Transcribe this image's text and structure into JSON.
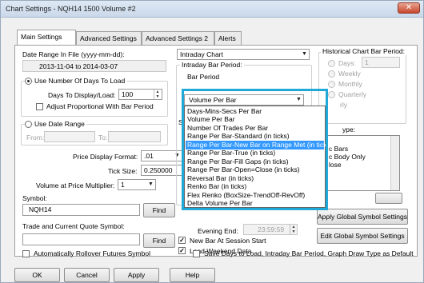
{
  "window": {
    "title": "Chart Settings - NQH14  1500 Volume  #2",
    "close_symbol": "✕"
  },
  "tabs": [
    {
      "label": "Main Settings",
      "active": true
    },
    {
      "label": "Advanced Settings",
      "active": false
    },
    {
      "label": "Advanced Settings 2",
      "active": false
    },
    {
      "label": "Alerts",
      "active": false
    }
  ],
  "date_range": {
    "label": "Date Range In File (yyyy-mm-dd):",
    "value": "2013-11-04 to 2014-03-07"
  },
  "days_group": {
    "radio_label": "Use Number Of Days To Load",
    "days_label": "Days To Display/Load:",
    "days_value": "100",
    "adjust_label": "Adjust Proportional With Bar Period"
  },
  "date_range_group": {
    "radio_label": "Use Date Range",
    "from_label": "From:",
    "to_label": "To:"
  },
  "price_format": {
    "label": "Price Display Format:",
    "value": ".01"
  },
  "tick_size": {
    "label": "Tick Size:",
    "value": "0.250000"
  },
  "volume_multiplier": {
    "label": "Volume at Price Multiplier:",
    "value": "1"
  },
  "symbol": {
    "label": "Symbol:",
    "value": "NQH14",
    "find_label": "Find"
  },
  "trade_symbol": {
    "label": "Trade and Current Quote Symbol:",
    "value": "",
    "find_label": "Find"
  },
  "rollover": {
    "label": "Automatically Rollover Futures Symbol"
  },
  "chart_type": {
    "value": "Intraday Chart"
  },
  "intraday_period": {
    "label": "Intraday Bar Period:",
    "bar_period_label": "Bar Period",
    "selected": "Volume Per Bar",
    "options": [
      "Days-Mins-Secs Per Bar",
      "Volume Per Bar",
      "Number Of Trades Per Bar",
      "Range Per Bar-Standard (in ticks)",
      "Range Per Bar-New Bar on Range Met (in ticks)",
      "Range Per Bar-True (in ticks)",
      "Range Per Bar-Fill Gaps (in ticks)",
      "Range Per Bar-Open=Close (in ticks)",
      "Reversal Bar (in ticks)",
      "Renko Bar (in ticks)",
      "Flex Renko (BoxSize-TrendOff-RevOff)",
      "Delta Volume Per Bar"
    ],
    "highlighted": "Range Per Bar-New Bar on Range Met (in ticks)"
  },
  "session_partial": {
    "s_letter": "S"
  },
  "evening_end": {
    "label": "Evening End:",
    "value": "23:59:59"
  },
  "new_bar_session": {
    "label": "New Bar At Session Start",
    "checked": true
  },
  "load_weekend": {
    "label": "Load Weekend Data",
    "checked": true
  },
  "historical": {
    "label": "Historical Chart Bar Period:",
    "days_label": "Days:",
    "days_value": "1",
    "weekly": "Weekly",
    "monthly": "Monthly",
    "quarterly": "Quarterly",
    "yearly_partial": "rly"
  },
  "draw_type": {
    "label_partial": "ype:",
    "items_partial": [
      "",
      "c Bars",
      "c Body Only",
      "lose",
      "",
      ""
    ]
  },
  "apply_global": {
    "label": "Apply Global Symbol Settings"
  },
  "edit_global": {
    "label": "Edit Global Symbol Settings"
  },
  "save_days": {
    "label": "Save Days to Load, Intraday Bar Period, Graph Draw Type as Default"
  },
  "buttons": {
    "ok": "OK",
    "cancel": "Cancel",
    "apply": "Apply",
    "help": "Help"
  },
  "colors": {
    "highlight_border": "#20a8d8",
    "selection": "#3399ff"
  }
}
